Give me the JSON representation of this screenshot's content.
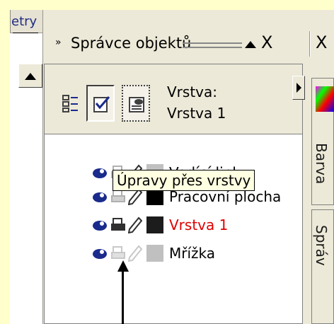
{
  "left_panel": {
    "label": "etry"
  },
  "header": {
    "expand_symbol": "»",
    "title": "Správce objektů",
    "close_label": "X",
    "close_label_2": "X"
  },
  "current_layer": {
    "label": "Vrstva:",
    "value": "Vrstva 1"
  },
  "side_tabs": [
    {
      "label": "Barva"
    },
    {
      "label": "Správ"
    }
  ],
  "layers": [
    {
      "name": "Vodící linky",
      "swatch": "#c0c0c0",
      "printer": "grey",
      "pencil": "dark",
      "color": "#000000"
    },
    {
      "name": "Pracovní plocha",
      "swatch": "#000000",
      "printer": "grey",
      "pencil": "dark",
      "color": "#000000"
    },
    {
      "name": "Vrstva 1",
      "swatch": "#000000",
      "printer": "dark",
      "pencil": "dark",
      "color": "#e00000"
    },
    {
      "name": "Mřížka",
      "swatch": "#c0c0c0",
      "printer": "light",
      "pencil": "light",
      "color": "#000000"
    }
  ],
  "tooltip": {
    "text": "Úpravy přes vrstvy"
  },
  "colors": {
    "background": "#ffffcc",
    "panel": "#ece9d8",
    "active_layer": "#e00000",
    "eye": "#1a2b8c"
  }
}
